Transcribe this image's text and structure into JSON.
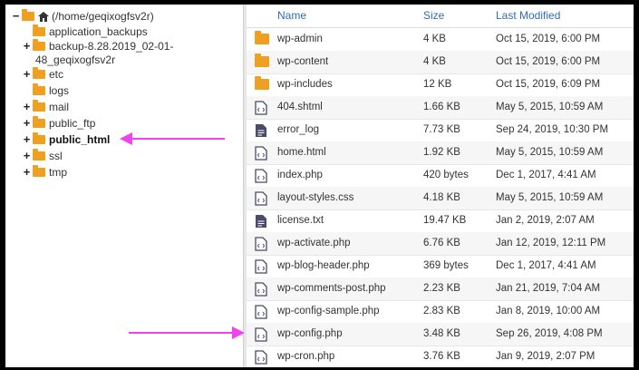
{
  "tree": {
    "root": "(/home/geqixogfsv2r)",
    "items": [
      {
        "label": "application_backups",
        "toggle": ""
      },
      {
        "label": "backup-8.28.2019_02-01-",
        "label2": "48_geqixogfsv2r",
        "toggle": "+"
      },
      {
        "label": "etc",
        "toggle": "+"
      },
      {
        "label": "logs",
        "toggle": ""
      },
      {
        "label": "mail",
        "toggle": "+"
      },
      {
        "label": "public_ftp",
        "toggle": "+"
      },
      {
        "label": "public_html",
        "toggle": "+"
      },
      {
        "label": "ssl",
        "toggle": "+"
      },
      {
        "label": "tmp",
        "toggle": "+"
      }
    ]
  },
  "columns": {
    "name": "Name",
    "size": "Size",
    "modified": "Last Modified"
  },
  "files": [
    {
      "name": "wp-admin",
      "size": "4 KB",
      "modified": "Oct 15, 2019, 6:00 PM",
      "type": "folder"
    },
    {
      "name": "wp-content",
      "size": "4 KB",
      "modified": "Oct 15, 2019, 6:00 PM",
      "type": "folder"
    },
    {
      "name": "wp-includes",
      "size": "12 KB",
      "modified": "Oct 15, 2019, 6:09 PM",
      "type": "folder"
    },
    {
      "name": "404.shtml",
      "size": "1.66 KB",
      "modified": "May 5, 2015, 10:59 AM",
      "type": "code"
    },
    {
      "name": "error_log",
      "size": "7.73 KB",
      "modified": "Sep 24, 2019, 10:30 PM",
      "type": "text"
    },
    {
      "name": "home.html",
      "size": "1.92 KB",
      "modified": "May 5, 2015, 10:59 AM",
      "type": "code"
    },
    {
      "name": "index.php",
      "size": "420 bytes",
      "modified": "Dec 1, 2017, 4:41 AM",
      "type": "code"
    },
    {
      "name": "layout-styles.css",
      "size": "4.18 KB",
      "modified": "May 5, 2015, 10:59 AM",
      "type": "code"
    },
    {
      "name": "license.txt",
      "size": "19.47 KB",
      "modified": "Jan 2, 2019, 2:07 AM",
      "type": "text"
    },
    {
      "name": "wp-activate.php",
      "size": "6.76 KB",
      "modified": "Jan 12, 2019, 12:11 PM",
      "type": "code"
    },
    {
      "name": "wp-blog-header.php",
      "size": "369 bytes",
      "modified": "Dec 1, 2017, 4:41 AM",
      "type": "code"
    },
    {
      "name": "wp-comments-post.php",
      "size": "2.23 KB",
      "modified": "Jan 21, 2019, 7:04 AM",
      "type": "code"
    },
    {
      "name": "wp-config-sample.php",
      "size": "2.83 KB",
      "modified": "Jan 8, 2019, 10:00 AM",
      "type": "code"
    },
    {
      "name": "wp-config.php",
      "size": "3.48 KB",
      "modified": "Sep 26, 2019, 4:08 PM",
      "type": "code"
    },
    {
      "name": "wp-cron.php",
      "size": "3.76 KB",
      "modified": "Jan 9, 2019, 2:07 PM",
      "type": "code"
    }
  ],
  "colors": {
    "accent": "#2f6db5",
    "folder": "#f0a020",
    "arrow": "#ee44ee",
    "file_icon": "#4a4a6a"
  }
}
